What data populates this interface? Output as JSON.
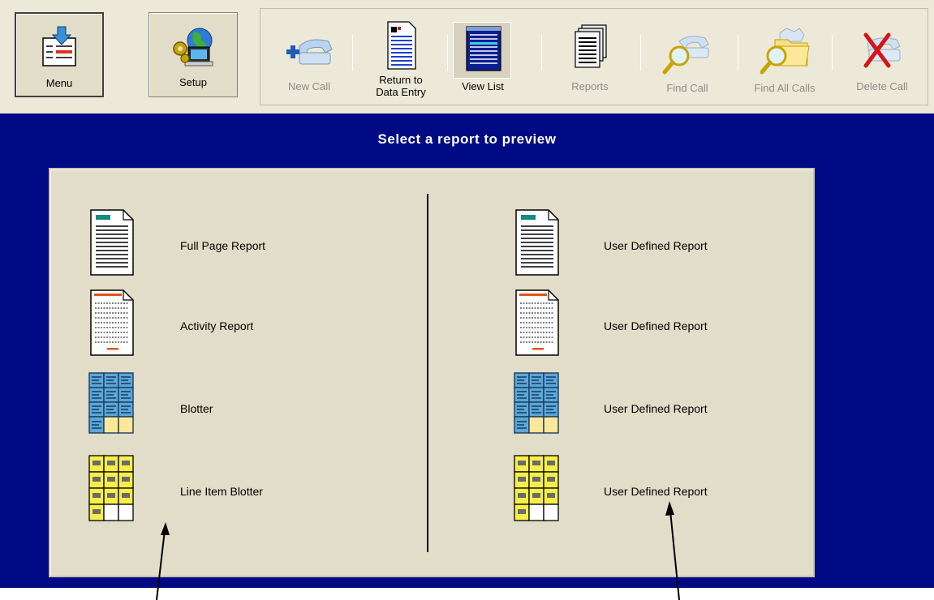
{
  "toolbar": {
    "menu": "Menu",
    "setup": "Setup",
    "buttons": {
      "new_call": "New Call",
      "return_line1": "Return to",
      "return_line2": "Data Entry",
      "view_list": "View List",
      "reports": "Reports",
      "find_call": "Find Call",
      "find_all_calls": "Find All Calls",
      "delete_call": "Delete Call"
    }
  },
  "main": {
    "title": "Select a report to preview",
    "left_reports": [
      {
        "label": "Full Page Report",
        "icon": "full-page-report-icon"
      },
      {
        "label": "Activity Report",
        "icon": "activity-report-icon"
      },
      {
        "label": "Blotter",
        "icon": "blotter-icon"
      },
      {
        "label": "Line Item Blotter",
        "icon": "line-item-blotter-icon"
      }
    ],
    "right_reports": [
      {
        "label": "User Defined Report",
        "icon": "full-page-report-icon"
      },
      {
        "label": "User Defined Report",
        "icon": "activity-report-icon"
      },
      {
        "label": "User Defined Report",
        "icon": "blotter-icon"
      },
      {
        "label": "User Defined Report",
        "icon": "line-item-blotter-icon"
      }
    ]
  },
  "colors": {
    "background_blue": "#000a84",
    "panel": "#e2ddc8",
    "toolbar": "#ece9d8",
    "disabled_text": "#8c8c8c"
  }
}
